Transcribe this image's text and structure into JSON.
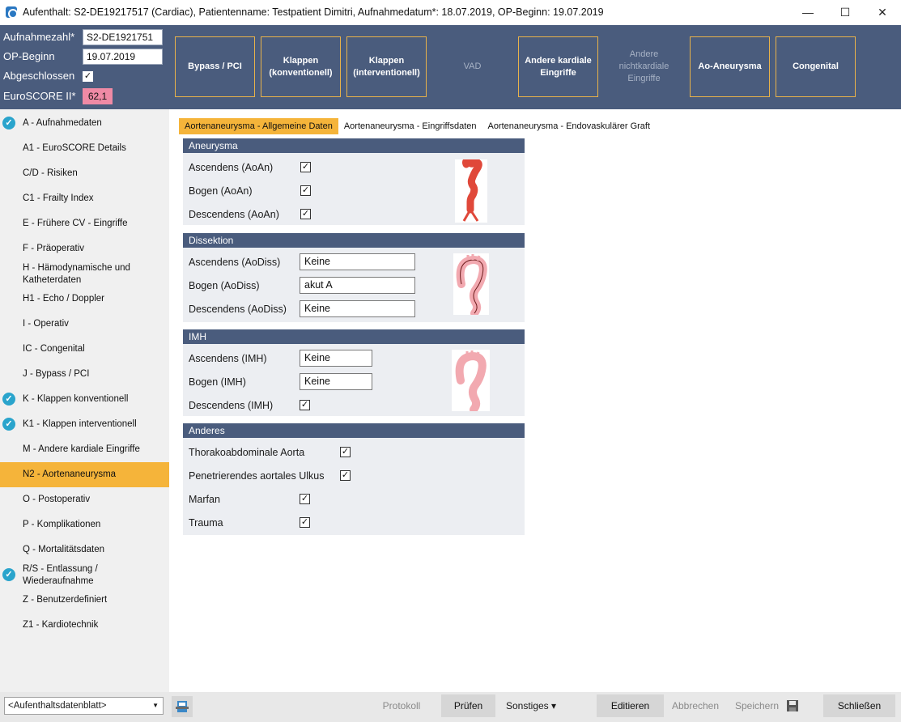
{
  "window": {
    "title": "Aufenthalt: S2-DE19217517 (Cardiac), Patientenname: Testpatient Dimitri, Aufnahmedatum*: 18.07.2019, OP-Beginn: 19.07.2019",
    "minimize": "—",
    "maximize": "☐",
    "close": "✕"
  },
  "header": {
    "aufnahmezahl_label": "Aufnahmezahl*",
    "aufnahmezahl_value": "S2-DE1921751",
    "opbeginn_label": "OP-Beginn",
    "opbeginn_value": "19.07.2019",
    "abgeschlossen_label": "Abgeschlossen",
    "abgeschlossen_checked": "✓",
    "euroscore_label": "EuroSCORE II*",
    "euroscore_value": "62,1",
    "euroscore_color": "#ef8aa5"
  },
  "nav_tiles": [
    {
      "label": "Bypass / PCI",
      "enabled": true
    },
    {
      "label": "Klappen (konventionell)",
      "enabled": true
    },
    {
      "label": "Klappen (interventionell)",
      "enabled": true
    },
    {
      "label": "VAD",
      "enabled": false
    },
    {
      "label": "Andere kardiale Eingriffe",
      "enabled": true
    },
    {
      "label": "Andere nichtkardiale Eingriffe",
      "enabled": false
    },
    {
      "label": "Ao-Aneurysma",
      "enabled": true
    },
    {
      "label": "Congenital",
      "enabled": true
    }
  ],
  "sidebar": {
    "check_glyph": "✓",
    "items": [
      {
        "label": "A - Aufnahmedaten",
        "done": true
      },
      {
        "label": "A1 - EuroSCORE Details",
        "done": false
      },
      {
        "label": "C/D - Risiken",
        "done": false
      },
      {
        "label": "C1 - Frailty Index",
        "done": false
      },
      {
        "label": "E - Frühere CV - Eingriffe",
        "done": false
      },
      {
        "label": "F - Präoperativ",
        "done": false
      },
      {
        "label": "H - Hämodynamische und Katheterdaten",
        "done": false
      },
      {
        "label": "H1 - Echo / Doppler",
        "done": false
      },
      {
        "label": "I - Operativ",
        "done": false
      },
      {
        "label": "IC - Congenital",
        "done": false
      },
      {
        "label": "J - Bypass / PCI",
        "done": false
      },
      {
        "label": "K - Klappen konventionell",
        "done": true
      },
      {
        "label": "K1 - Klappen interventionell",
        "done": true
      },
      {
        "label": "M - Andere kardiale Eingriffe",
        "done": false
      },
      {
        "label": "N2 - Aortenaneurysma",
        "done": false,
        "active": true
      },
      {
        "label": "O - Postoperativ",
        "done": false
      },
      {
        "label": "P - Komplikationen",
        "done": false
      },
      {
        "label": "Q - Mortalitätsdaten",
        "done": false
      },
      {
        "label": "R/S - Entlassung / Wiederaufnahme",
        "done": true
      },
      {
        "label": "Z - Benutzerdefiniert",
        "done": false
      },
      {
        "label": "Z1 - Kardiotechnik",
        "done": false
      }
    ]
  },
  "tabs": [
    {
      "label": "Aortenaneurysma - Allgemeine Daten",
      "active": true
    },
    {
      "label": "Aortenaneurysma - Eingriffsdaten",
      "active": false
    },
    {
      "label": "Aortenaneurysma - Endovaskulärer Graft",
      "active": false
    }
  ],
  "groups": {
    "aneurysma": {
      "title": "Aneurysma",
      "rows": [
        {
          "label": "Ascendens (AoAn)",
          "checked": "✓"
        },
        {
          "label": "Bogen (AoAn)",
          "checked": "✓"
        },
        {
          "label": "Descendens (AoAn)",
          "checked": "✓"
        }
      ]
    },
    "dissektion": {
      "title": "Dissektion",
      "rows": [
        {
          "label": "Ascendens (AoDiss)",
          "value": "Keine"
        },
        {
          "label": "Bogen (AoDiss)",
          "value": "akut A"
        },
        {
          "label": "Descendens (AoDiss)",
          "value": "Keine"
        }
      ]
    },
    "imh": {
      "title": "IMH",
      "rows": [
        {
          "label": "Ascendens (IMH)",
          "value": "Keine"
        },
        {
          "label": "Bogen (IMH)",
          "value": "Keine"
        },
        {
          "label": "Descendens (IMH)",
          "checked": "✓"
        }
      ]
    },
    "anderes": {
      "title": "Anderes",
      "rows": [
        {
          "label": "Thorakoabdominale Aorta",
          "checked": "✓"
        },
        {
          "label": "Penetrierendes aortales Ulkus",
          "checked": "✓"
        },
        {
          "label": "Marfan",
          "checked": "✓"
        },
        {
          "label": "Trauma",
          "checked": "✓"
        }
      ]
    }
  },
  "footer": {
    "select_value": "<Aufenthaltsdatenblatt>",
    "select_arrow": "▼",
    "protokoll": "Protokoll",
    "pruefen": "Prüfen",
    "sonstiges": "Sonstiges ▾",
    "editieren": "Editieren",
    "abbrechen": "Abbrechen",
    "speichern": "Speichern",
    "schliessen": "Schließen"
  },
  "colors": {
    "header_bg": "#4a5c7d",
    "accent": "#f5b43a",
    "check": "#2aa4cc",
    "aneurysm_red": "#e0483a",
    "aorta_pink": "#f2a9b0"
  }
}
